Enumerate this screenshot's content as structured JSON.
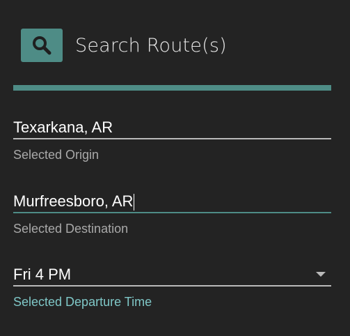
{
  "header": {
    "search_icon": "search-icon",
    "title": "Search Route(s)"
  },
  "colors": {
    "accent": "#4e8c86",
    "background": "#232323",
    "hint_accent": "#7fc7c7"
  },
  "origin": {
    "value": "Texarkana, AR",
    "hint": "Selected Origin"
  },
  "destination": {
    "value": "Murfreesboro, AR",
    "hint": "Selected Destination"
  },
  "departure": {
    "selected": "Fri 4 PM",
    "hint": "Selected Departure Time",
    "icon": "chevron-down-icon"
  }
}
